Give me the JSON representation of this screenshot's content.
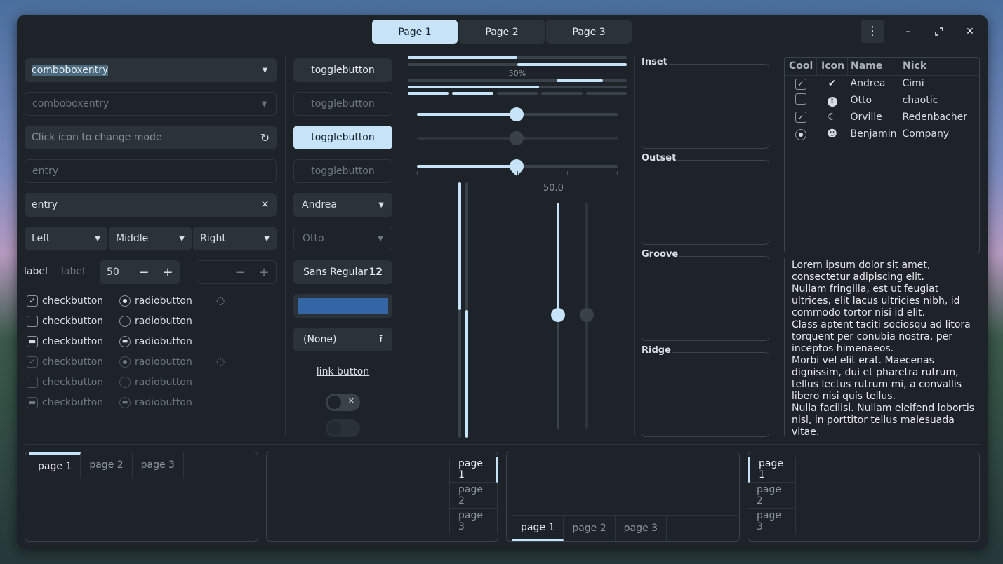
{
  "header": {
    "tabs": [
      "Page 1",
      "Page 2",
      "Page 3"
    ],
    "active_tab": 0
  },
  "col1": {
    "combo1": "comboboxentry",
    "combo2": "comboboxentry",
    "mode_entry_placeholder": "Click icon to change mode",
    "entry1": "entry",
    "entry2": "entry",
    "seg": [
      "Left",
      "Middle",
      "Right"
    ],
    "label_a": "label",
    "label_b": "label",
    "spin_value": "50",
    "check_label": "checkbutton",
    "radio_label": "radiobutton"
  },
  "col2": {
    "toggle": "togglebutton",
    "combo_andrea": "Andrea",
    "combo_otto": "Otto",
    "font_name": "Sans Regular",
    "font_size": "12",
    "file_none": "(None)",
    "link": "link button",
    "color": "#3465a4"
  },
  "col3": {
    "progress_label": "50%",
    "scale_value": "50.0"
  },
  "frames": [
    "Inset",
    "Outset",
    "Groove",
    "Ridge"
  ],
  "tree": {
    "columns": [
      "Cool",
      "Icon",
      "Name",
      "Nick"
    ],
    "rows": [
      {
        "cool": "checked",
        "icon": "check-circle-icon",
        "name": "Andrea",
        "nick": "Cimi"
      },
      {
        "cool": "unchecked",
        "icon": "warning-icon",
        "name": "Otto",
        "nick": "chaotic"
      },
      {
        "cool": "checked",
        "icon": "moon-icon",
        "name": "Orville",
        "nick": "Redenbacher"
      },
      {
        "cool": "radio",
        "icon": "face-icon",
        "name": "Benjamin",
        "nick": "Company"
      }
    ]
  },
  "text_view": "Lorem ipsum dolor sit amet, consectetur adipiscing elit.\nNullam fringilla, est ut feugiat ultrices, elit lacus ultricies nibh, id commodo tortor nisi id elit.\nClass aptent taciti sociosqu ad litora torquent per conubia nostra, per inceptos himenaeos.\nMorbi vel elit erat. Maecenas dignissim, dui et pharetra rutrum, tellus lectus rutrum mi, a convallis libero nisi quis tellus.\nNulla facilisi. Nullam eleifend lobortis nisl, in porttitor tellus malesuada vitae.",
  "notebooks": {
    "tabs": [
      "page 1",
      "page 2",
      "page 3"
    ]
  },
  "colors": {
    "accent": "#c7e3f7",
    "window_bg": "#1d2328"
  }
}
